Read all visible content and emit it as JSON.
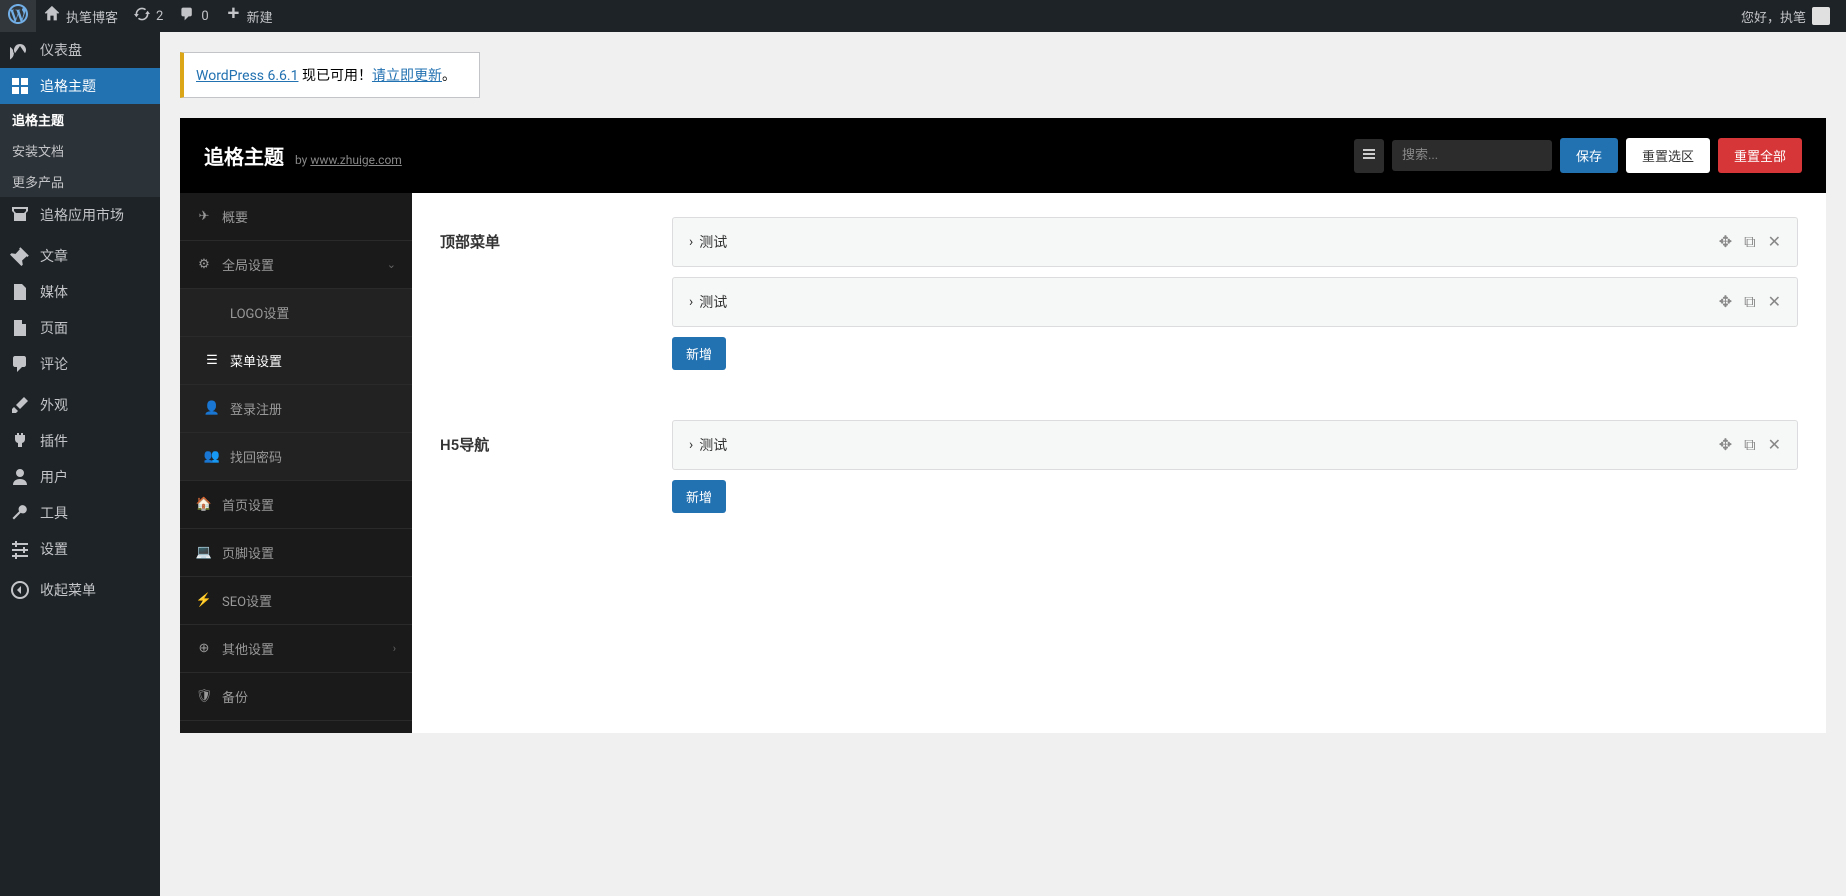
{
  "adminbar": {
    "site_name": "执笔博客",
    "updates_count": "2",
    "comments_count": "0",
    "new_label": "新建",
    "greeting": "您好，执笔"
  },
  "wp_menu": {
    "dashboard": "仪表盘",
    "zhuige_theme": "追格主题",
    "sub_theme": "追格主题",
    "sub_docs": "安装文档",
    "sub_more": "更多产品",
    "marketplace": "追格应用市场",
    "posts": "文章",
    "media": "媒体",
    "pages": "页面",
    "comments": "评论",
    "appearance": "外观",
    "plugins": "插件",
    "users": "用户",
    "tools": "工具",
    "settings": "设置",
    "collapse": "收起菜单"
  },
  "notice": {
    "link1": "WordPress 6.6.1",
    "text1": " 现已可用！",
    "link2": "请立即更新",
    "text2": "。"
  },
  "theme_header": {
    "title": "追格主题",
    "by": "by ",
    "link": "www.zhuige.com",
    "search_placeholder": "搜索...",
    "save": "保存",
    "reset_section": "重置选区",
    "reset_all": "重置全部"
  },
  "settings_nav": {
    "overview": "概要",
    "global": "全局设置",
    "logo": "LOGO设置",
    "menu": "菜单设置",
    "login": "登录注册",
    "password": "找回密码",
    "homepage": "首页设置",
    "footer": "页脚设置",
    "seo": "SEO设置",
    "other": "其他设置",
    "backup": "备份"
  },
  "fields": {
    "top_menu": {
      "label": "顶部菜单",
      "items": [
        "测试",
        "测试"
      ],
      "add": "新增"
    },
    "h5_nav": {
      "label": "H5导航",
      "items": [
        "测试"
      ],
      "add": "新增"
    }
  }
}
